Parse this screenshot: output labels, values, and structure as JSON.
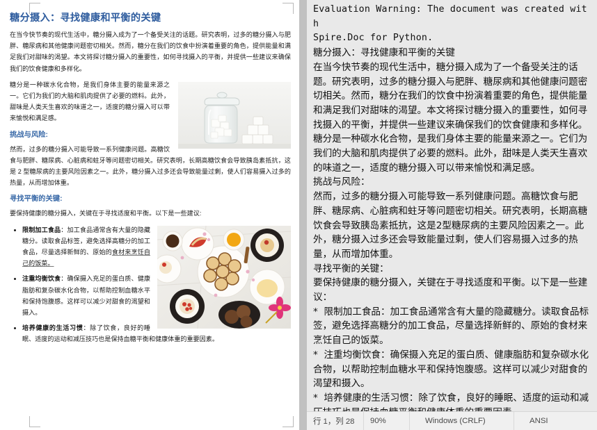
{
  "document": {
    "title": "糖分摄入：寻找健康和平衡的关键",
    "intro": "在当今快节奏的现代生活中，糖分摄入成为了一个备受关注的话题。研究表明，过多的糖分摄入与肥胖、糖尿病和其他健康问题密切相关。然而，糖分在我们的饮食中扮演着重要的角色，提供能量和满足我们对甜味的渴望。本文将探讨糖分摄入的重要性，如何寻找摄入的平衡，并提供一些建议来确保我们的饮食健康和多样化。",
    "para_sugar": "糖分是一种碳水化合物，是我们身体主要的能量来源之一。它们为我们的大脑和肌肉提供了必要的燃料。此外，甜味是人类天生喜欢的味道之一，适度的糖分摄入可以带来愉悦和满足感。",
    "heading_risk": "挑战与风险:",
    "para_risk": "然而，过多的糖分摄入可能导致一系列健康问题。高糖饮食与肥胖、糖尿病、心脏病和蛀牙等问题密切相关。研究表明，长期高糖饮食会导致胰岛素抵抗，这是 2 型糖尿病的主要风险因素之一。此外，糖分摄入过多还会导致能量过剩，使人们容易摄入过多的热量，从而增加体重。",
    "heading_balance": "寻找平衡的关键:",
    "para_balance": "要保持健康的糖分摄入，关键在于寻找适度和平衡。以下是一些建议:",
    "bullets": [
      {
        "term": "限制加工食品",
        "sep": "：",
        "text_a": "加工食品通常含有大量的隐藏糖分。读取食品标签，避免选择高糖分的加工食品，尽量选择新鲜的、原始的",
        "text_underlined": "食材来烹饪自己的饭菜。"
      },
      {
        "term": "注重均衡饮食",
        "sep": "：",
        "text_a": "确保摄入充足的蛋白质、健康脂肪和复杂碳水化合物，以帮助控制血糖水平和保持饱腹感。这样可以减少对甜食的渴望和摄入。",
        "text_underlined": ""
      },
      {
        "term": "培养健康的生活习惯",
        "sep": "：",
        "text_a": "除了饮食，良好的睡眠、适度的运动和减压技巧也是保持血糖平衡和健康体重的重要因素。",
        "text_underlined": ""
      }
    ],
    "images": [
      {
        "name": "sugar-jar-photo",
        "alt": "玻璃罐中的方糖与方糖堆"
      },
      {
        "name": "dessert-table-photo",
        "alt": "俯拍摆满甜点的餐桌"
      }
    ]
  },
  "editor": {
    "lines": [
      {
        "style": "mono",
        "text": "Evaluation Warning: The document was created with"
      },
      {
        "style": "mono",
        "text": "Spire.Doc for Python."
      },
      {
        "style": "cjk",
        "text": "糖分摄入：寻找健康和平衡的关键"
      },
      {
        "style": "cjk",
        "text": "在当今快节奏的现代生活中，糖分摄入成为了一个备受关注的话题。研究表明，过多的糖分摄入与肥胖、糖尿病和其他健康问题密切相关。然而，糖分在我们的饮食中扮演着重要的角色，提供能量和满足我们对甜味的渴望。本文将探讨糖分摄入的重要性，如何寻找摄入的平衡，并提供一些建议来确保我们的饮食健康和多样化。"
      },
      {
        "style": "cjk",
        "text": "糖分是一种碳水化合物，是我们身体主要的能量来源之一。它们为我们的大脑和肌肉提供了必要的燃料。此外，甜味是人类天生喜欢的味道之一，适度的糖分摄入可以带来愉悦和满足感。"
      },
      {
        "style": "cjk",
        "text": "挑战与风险："
      },
      {
        "style": "cjk",
        "text": "然而，过多的糖分摄入可能导致一系列健康问题。高糖饮食与肥胖、糖尿病、心脏病和蛀牙等问题密切相关。研究表明，长期高糖饮食会导致胰岛素抵抗，这是2型糖尿病的主要风险因素之一。此外，糖分摄入过多还会导致能量过剩，使人们容易摄入过多的热量，从而增加体重。"
      },
      {
        "style": "cjk",
        "text": "寻找平衡的关键："
      },
      {
        "style": "cjk",
        "text": "要保持健康的糖分摄入，关键在于寻找适度和平衡。以下是一些建议："
      },
      {
        "style": "cjk",
        "text": "*  限制加工食品：加工食品通常含有大量的隐藏糖分。读取食品标签，避免选择高糖分的加工食品，尽量选择新鲜的、原始的食材来烹饪自己的饭菜。"
      },
      {
        "style": "cjk",
        "text": "*  注重均衡饮食：确保摄入充足的蛋白质、健康脂肪和复杂碳水化合物，以帮助控制血糖水平和保持饱腹感。这样可以减少对甜食的渴望和摄入。"
      },
      {
        "style": "cjk",
        "text": "*  培养健康的生活习惯：除了饮食，良好的睡眠、适度的运动和减压技巧也是保持血糖平衡和健康体重的重要因素。"
      }
    ]
  },
  "statusbar": {
    "position": "行 1，列 28",
    "zoom": "90%",
    "line_ending": "Windows (CRLF)",
    "encoding": "ANSI"
  },
  "colors": {
    "heading_blue": "#2e5c9e",
    "subheading_blue": "#3a6aa8",
    "editor_bg": "#e9e9e9",
    "statusbar_bg": "#f0f0f0",
    "gutter": "#c3c3c3"
  }
}
